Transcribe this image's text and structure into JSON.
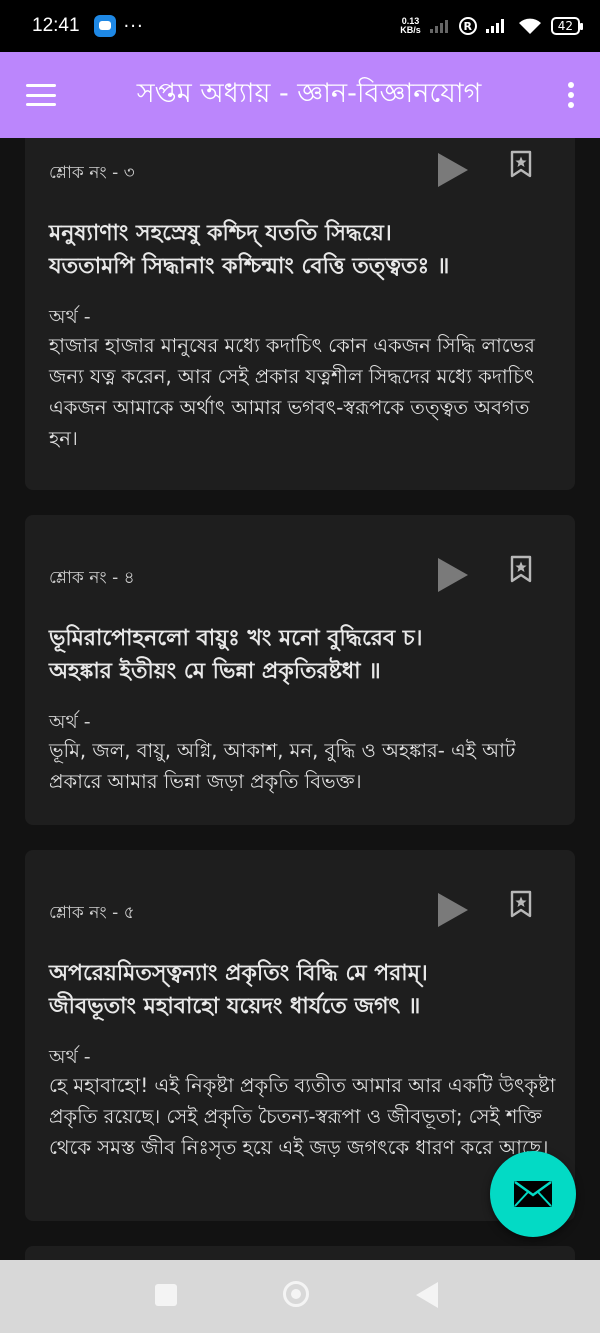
{
  "status_bar": {
    "time": "12:41",
    "more": "···",
    "speed_value": "0.13",
    "speed_unit": "KB/s",
    "r_badge": "R",
    "battery": "42"
  },
  "app_bar": {
    "title": "সপ্তম অধ্যায় - জ্ঞান-বিজ্ঞানযোগ"
  },
  "meaning_label": "অর্থ -",
  "cards": [
    {
      "verse_no": "শ্লোক নং - ৩",
      "shloka": [
        "মনুষ্যাণাং সহস্রেষু কশ্চিদ্ যততি সিদ্ধয়ে।",
        "যততামপি সিদ্ধানাং কশ্চিন্মাং বেত্তি তত্ত্বতঃ ॥"
      ],
      "meaning": "হাজার হাজার মানুষের মধ্যে কদাচিৎ কোন একজন সিদ্ধি লাভের জন্য যত্ন করেন, আর সেই প্রকার যত্নশীল সিদ্ধদের মধ্যে কদাচিৎ একজন আমাকে অর্থাৎ আমার ভগবৎ-স্বরূপকে তত্ত্বত অবগত হন।"
    },
    {
      "verse_no": "শ্লোক নং - ৪",
      "shloka": [
        "ভূমিরাপোহনলো বায়ুঃ খং মনো বুদ্ধিরেব চ।",
        "অহঙ্কার ইতীয়ং মে ভিন্না প্রকৃতিরষ্টধা ॥"
      ],
      "meaning": "ভূমি, জল, বায়ু, অগ্নি, আকাশ, মন, বুদ্ধি ও অহঙ্কার- এই আট প্রকারে আমার ভিন্না জড়া প্রকৃতি বিভক্ত।"
    },
    {
      "verse_no": "শ্লোক নং - ৫",
      "shloka": [
        "অপরেয়মিতস্ত্বন্যাং প্রকৃতিং বিদ্ধি মে পরাম্।",
        "জীবভূতাং মহাবাহো যয়েদং ধার্যতে জগৎ ॥"
      ],
      "meaning": "হে মহাবাহো! এই নিকৃষ্টা প্রকৃতি ব্যতীত আমার আর একটি উৎকৃষ্টা প্রকৃতি রয়েছে। সেই প্রকৃতি চৈতন্য-স্বরূপা ও জীবভূতা; সেই শক্তি থেকে সমস্ত জীব নিঃসৃত হয়ে এই জড় জগৎকে ধারণ করে আছে।"
    }
  ],
  "colors": {
    "app_bar": "#bb86fc",
    "fab": "#03dac5",
    "card": "#1e1e1e",
    "background": "#121212"
  },
  "icons": {
    "menu": "hamburger-menu-icon",
    "overflow": "more-vert-icon",
    "play": "play-icon",
    "bookmark": "bookmark-star-icon",
    "fab": "mail-icon"
  }
}
